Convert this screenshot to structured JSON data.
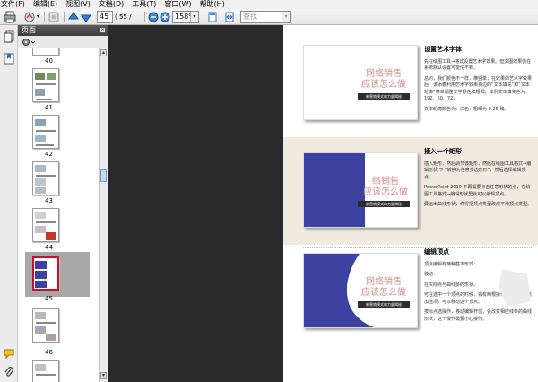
{
  "menu": [
    "文件(F)",
    "编辑(E)",
    "视图(V)",
    "文档(D)",
    "工具(T)",
    "窗口(W)",
    "帮助(H)"
  ],
  "toolbar": {
    "page_current": "45",
    "page_total": "( 55 / 184 )",
    "zoom": "158%",
    "search_placeholder": "查找"
  },
  "panel": {
    "title": "页面",
    "close": "x",
    "thumbnails": [
      "40",
      "41",
      "42",
      "43",
      "44",
      "45",
      "46"
    ],
    "selected": "45"
  },
  "slides": [
    {
      "title_line1": "网络销售",
      "title_line2": "应该怎么做",
      "subtitle": "新营销模式的力量揭秘"
    },
    {
      "title_line1": "络销售",
      "title_line2": "应该怎么做",
      "subtitle": "新营销模式的力量揭秘"
    },
    {
      "title_line1": "网络销售",
      "title_line2": "应该怎么做",
      "subtitle": "新营销模式的力量揭秘"
    }
  ],
  "sections": [
    {
      "heading": "设置艺术字体",
      "paragraphs": [
        "先在绘图工具→格式设置艺术字效果。但文图效果仍在系统默认设置可能伦不到。",
        "总的，我们颜色不一样，横竖单，在效果的艺术字效果后，该添着利用艺术字效果将边的“文本填充”和“文本轮廓”菜单调整文字颜色和粗细，本例文本填充色为：192、60、72。",
        "文本轮廓颜色为：白色，粗细为 0.25 磅。"
      ]
    },
    {
      "heading": "插入一个矩形",
      "paragraphs": [
        "插入矩形，然后调节该矩形，然后在绘图工具格式→编辑形状 下 “转换为任意多边形形”，然后选择编辑顶点。",
        "PowerPoint 2010 不再需要点击任意形状的点，在绘图工具格式→编辑形状里就可以编辑顶点。",
        "要画出曲线形状，你得把顶点类型改成平滑顶点类型。"
      ]
    },
    {
      "heading": "编辑顶点",
      "paragraphs": [
        "顶点编辑有两种基本形式：",
        "移动：",
        "在实际点与曲线多的形状。",
        "可在选中一个顶点的时候，会有两根操作话线，拖动点加选项，可以移动这个顶点。",
        "按标点选操作，移动编辑杆位，会改变相应线条的曲线形状，这个操作需要小心操作。"
      ]
    }
  ],
  "colors": {
    "slide_blue": "#3d42a0",
    "slide_title_pink": "#d48a8a",
    "gutter": "#2a2a2a",
    "selected_thumb_border": "#c8102e"
  }
}
